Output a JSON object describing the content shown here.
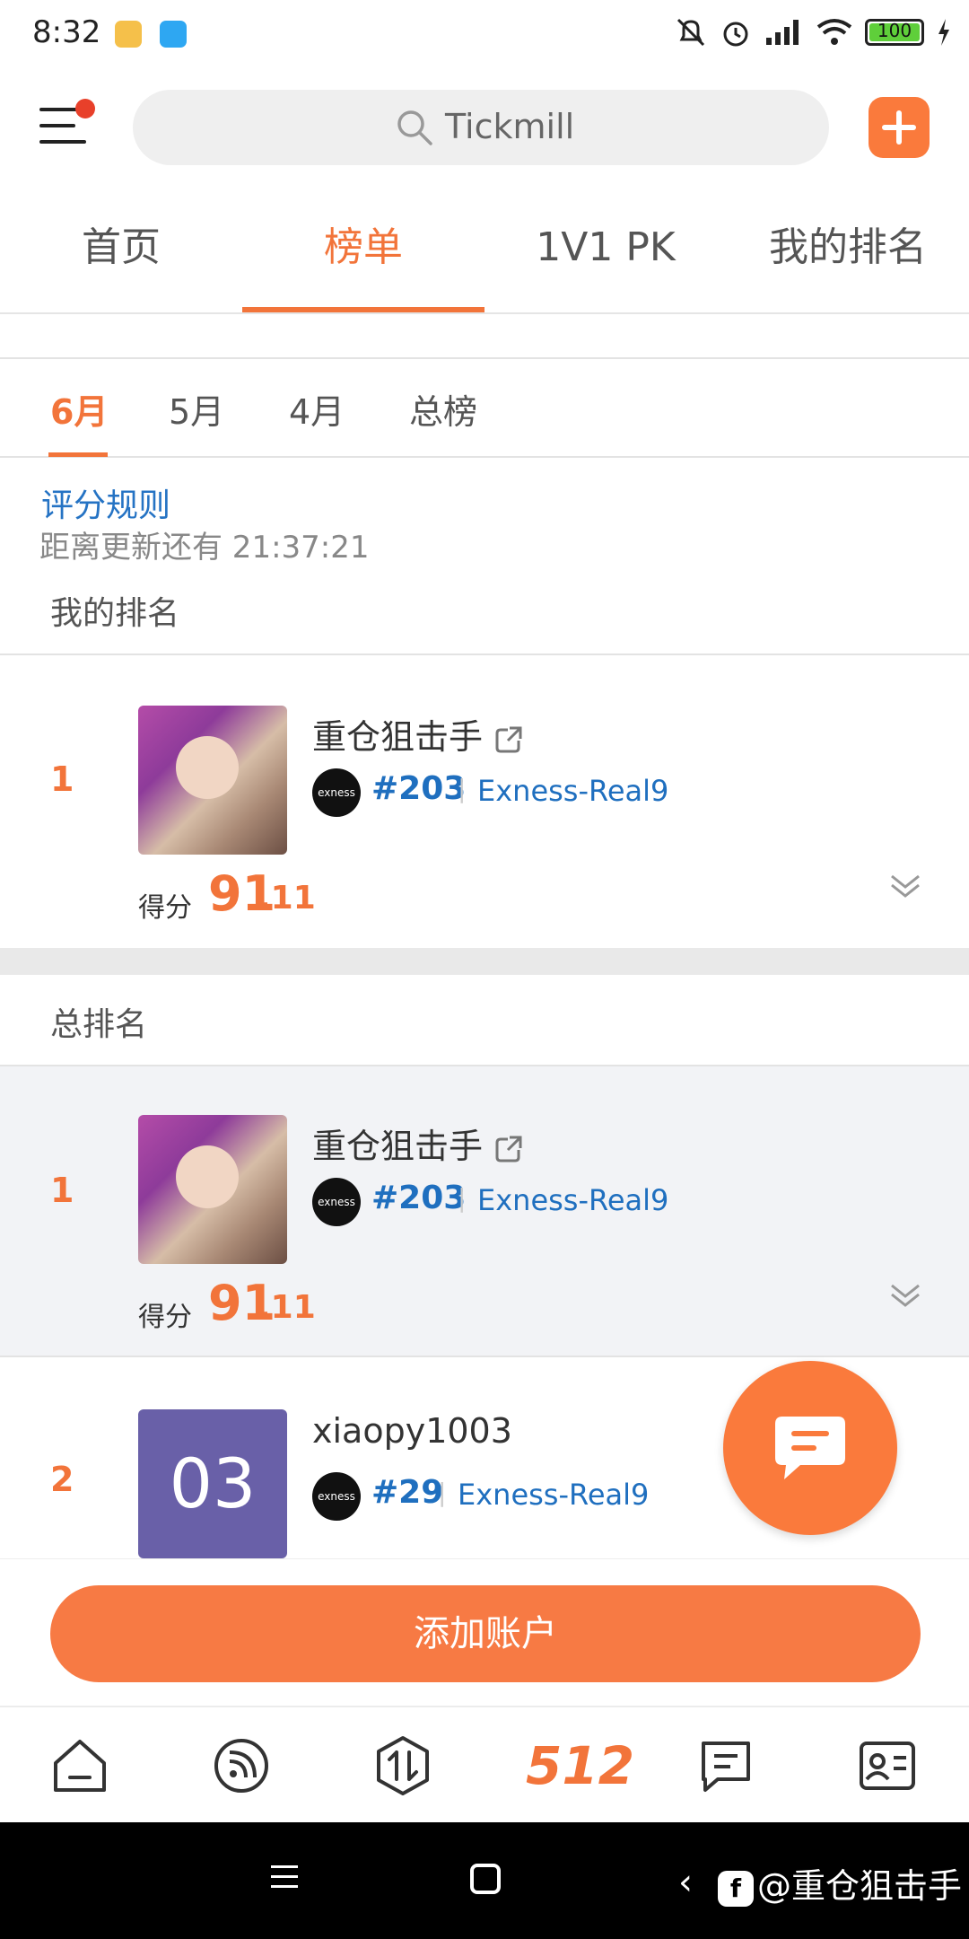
{
  "status_bar": {
    "time": "8:32",
    "battery": "100"
  },
  "header": {
    "search_placeholder": "Tickmill"
  },
  "top_tabs": [
    {
      "label": "首页"
    },
    {
      "label": "榜单",
      "active": true
    },
    {
      "label": "1V1 PK"
    },
    {
      "label": "我的排名"
    }
  ],
  "month_tabs": [
    {
      "label": "6月",
      "active": true
    },
    {
      "label": "5月"
    },
    {
      "label": "4月"
    },
    {
      "label": "总榜"
    }
  ],
  "info": {
    "rules_link": "评分规则",
    "countdown": "距离更新还有 21:37:21",
    "my_rank_title": "我的排名",
    "total_rank_title": "总排名"
  },
  "my_rank": {
    "rank": "1",
    "name": "重仓狙击手",
    "broker_logo": "exness",
    "account_id": "#203",
    "server": "Exness-Real9",
    "score_label": "得分",
    "score_int": "91",
    "score_dec": ".11"
  },
  "total_rank": [
    {
      "rank": "1",
      "name": "重仓狙击手",
      "broker_logo": "exness",
      "account_id": "#203",
      "server": "Exness-Real9",
      "score_label": "得分",
      "score_int": "91",
      "score_dec": ".11"
    },
    {
      "rank": "2",
      "name": "xiaopy1003",
      "avatar_text": "03",
      "broker_logo": "exness",
      "account_id": "#29",
      "server": "Exness-Real9"
    }
  ],
  "add_account_label": "添加账户",
  "bottom_nav": {
    "items": [
      "home-icon",
      "feed-icon",
      "exchange-icon",
      "rank-512-icon",
      "message-icon",
      "profile-card-icon"
    ],
    "active_label": "512"
  },
  "watermark": "@重仓狙击手",
  "colors": {
    "accent": "#f2743a",
    "link": "#1f6fbf",
    "avatar_purple": "#6960a8"
  }
}
